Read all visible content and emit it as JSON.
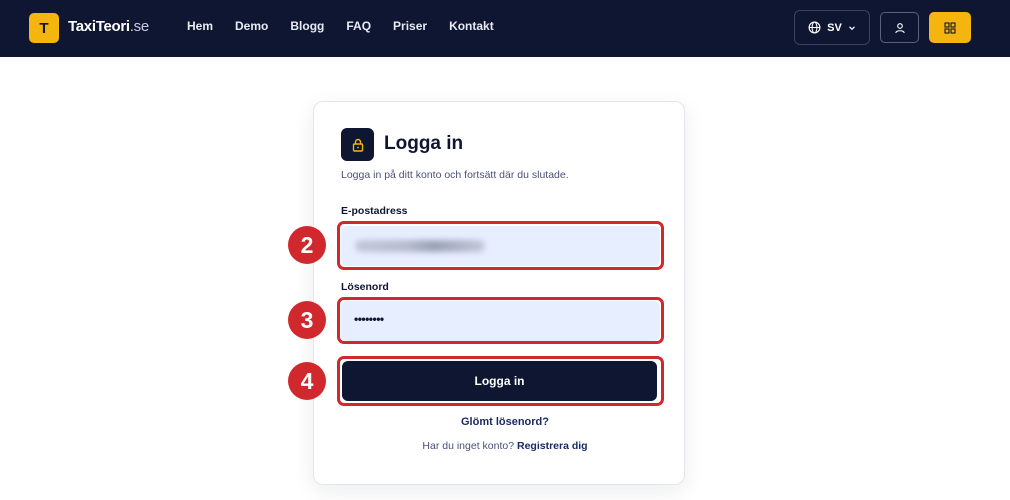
{
  "header": {
    "logo_letter": "T",
    "brand_name": "TaxiTeori",
    "brand_tld": ".se",
    "nav": [
      "Hem",
      "Demo",
      "Blogg",
      "FAQ",
      "Priser",
      "Kontakt"
    ],
    "language": "SV"
  },
  "login": {
    "title": "Logga in",
    "subtitle": "Logga in på ditt konto och fortsätt där du slutade.",
    "email_label": "E-postadress",
    "password_label": "Lösenord",
    "password_value": "••••••••",
    "submit_label": "Logga in",
    "forgot_label": "Glömt lösenord?",
    "no_account_text": "Har du inget konto?",
    "register_label": "Registrera dig"
  },
  "markers": [
    "2",
    "3",
    "4"
  ],
  "colors": {
    "navbar_bg": "#0f1631",
    "accent_yellow": "#f5b50f",
    "input_bg": "#e7eeff",
    "highlight_red": "#d0282c"
  }
}
